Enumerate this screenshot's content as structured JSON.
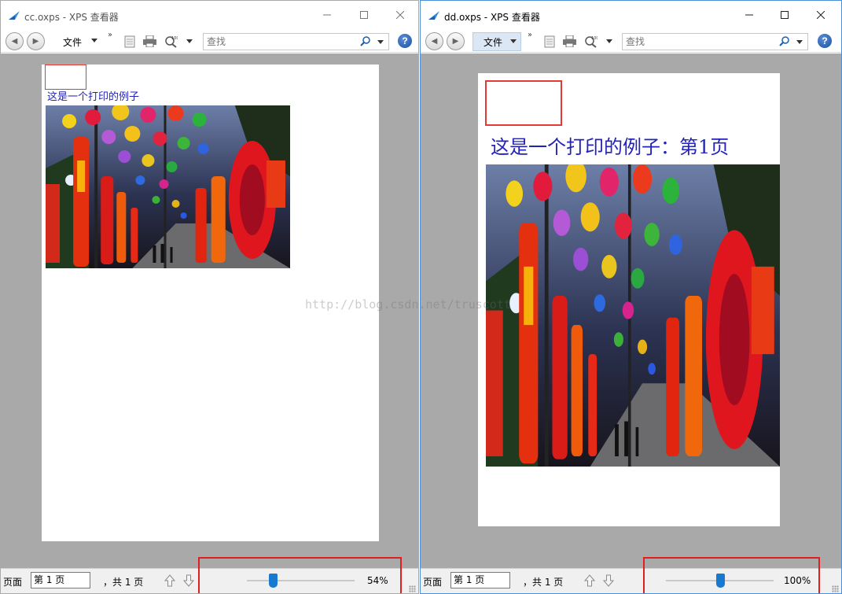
{
  "left_window": {
    "title": "cc.oxps - XPS 查看器",
    "file_menu_label": "文件",
    "search_placeholder": "查找",
    "document": {
      "heading": "这是一个打印的例子"
    },
    "status": {
      "page_label": "页面",
      "page_value": "第 1 页",
      "total_label": "，共 1 页",
      "zoom_label": "54%",
      "zoom_percent": 54
    }
  },
  "right_window": {
    "title": "dd.oxps - XPS 查看器",
    "file_menu_label": "文件",
    "search_placeholder": "查找",
    "document": {
      "heading": "这是一个打印的例子：第1页"
    },
    "status": {
      "page_label": "页面",
      "page_value": "第 1 页",
      "total_label": "，共 1 页",
      "zoom_label": "100%",
      "zoom_percent": 100
    }
  },
  "watermark": "http://blog.csdn.net/truscott",
  "colors": {
    "viewer_background": "#a9a9a9",
    "document_text": "#2323b8",
    "highlight_red": "#e02020",
    "slider_thumb": "#1979d1"
  }
}
